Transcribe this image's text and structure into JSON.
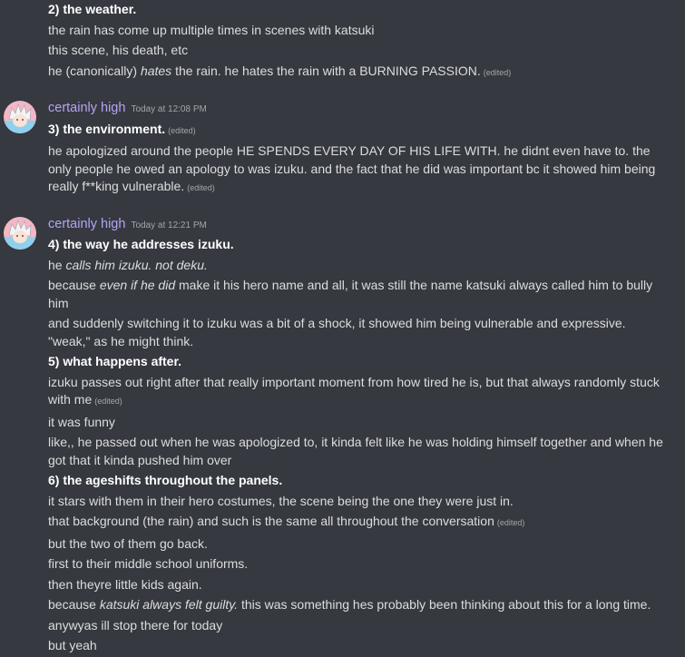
{
  "messages": [
    {
      "continuation": true,
      "lines": [
        {
          "parts": [
            {
              "b": "2) the weather."
            }
          ]
        },
        {
          "parts": [
            {
              "t": "the rain has come up multiple times in scenes with katsuki"
            }
          ]
        },
        {
          "parts": [
            {
              "t": "this scene, his death, etc"
            }
          ]
        },
        {
          "parts": [
            {
              "t": "he (canonically) "
            },
            {
              "i": "hates"
            },
            {
              "t": " the rain. he hates the rain with a BURNING PASSION."
            }
          ],
          "edited": "(edited)"
        }
      ]
    },
    {
      "author": "certainly high",
      "timestamp": "Today at 12:08 PM",
      "lines": [
        {
          "parts": [
            {
              "b": "3) the environment."
            }
          ],
          "edited": "(edited)"
        },
        {
          "parts": [
            {
              "t": "he apologized around the people HE SPENDS EVERY DAY OF HIS LIFE WITH. he didnt even have to. the only people he owed an apology to was izuku. and the fact that he did was important bc it showed him being really f**king vulnerable."
            }
          ],
          "edited": "(edited)"
        }
      ]
    },
    {
      "author": "certainly high",
      "timestamp": "Today at 12:21 PM",
      "lines": [
        {
          "parts": [
            {
              "b": "4) the way he addresses izuku."
            }
          ]
        },
        {
          "parts": [
            {
              "t": "he "
            },
            {
              "i": "calls him izuku. not deku."
            }
          ]
        },
        {
          "parts": [
            {
              "t": "because "
            },
            {
              "i": "even if he did"
            },
            {
              "t": " make it his hero name and all, it was still the name katsuki always called him to bully him"
            }
          ]
        },
        {
          "parts": [
            {
              "t": "and suddenly switching it to izuku was a bit of a shock, it showed him being vulnerable and expressive. \"weak,\" as he might think."
            }
          ]
        },
        {
          "parts": [
            {
              "b": "5) what happens after."
            }
          ]
        },
        {
          "parts": [
            {
              "t": "izuku passes out right after that really important moment from how tired he is, but that always randomly stuck with me"
            }
          ],
          "edited": "(edited)"
        },
        {
          "parts": [
            {
              "t": "it was funny"
            }
          ]
        },
        {
          "parts": [
            {
              "t": "like,, he passed out when he was apologized to, it kinda felt like he was holding himself together and when he got that it kinda pushed him over"
            }
          ]
        },
        {
          "parts": [
            {
              "b": "6) the ageshifts throughout the panels."
            }
          ]
        },
        {
          "parts": [
            {
              "t": "it stars with them in their hero costumes, the scene being the one they were just in."
            }
          ]
        },
        {
          "parts": [
            {
              "t": "that background (the rain) and such is the same all throughout the conversation"
            }
          ],
          "edited": "(edited)"
        },
        {
          "parts": [
            {
              "t": "but the two of them go back."
            }
          ]
        },
        {
          "parts": [
            {
              "t": "first to their middle school uniforms."
            }
          ]
        },
        {
          "parts": [
            {
              "t": "then theyre little kids again."
            }
          ]
        },
        {
          "parts": [
            {
              "t": "because "
            },
            {
              "i": "katsuki always felt guilty."
            },
            {
              "t": " this was something hes probably been thinking about this for a long time."
            }
          ]
        },
        {
          "parts": [
            {
              "t": "anywyas ill stop there for today"
            }
          ]
        },
        {
          "parts": [
            {
              "t": "but yeah"
            }
          ]
        }
      ]
    }
  ]
}
